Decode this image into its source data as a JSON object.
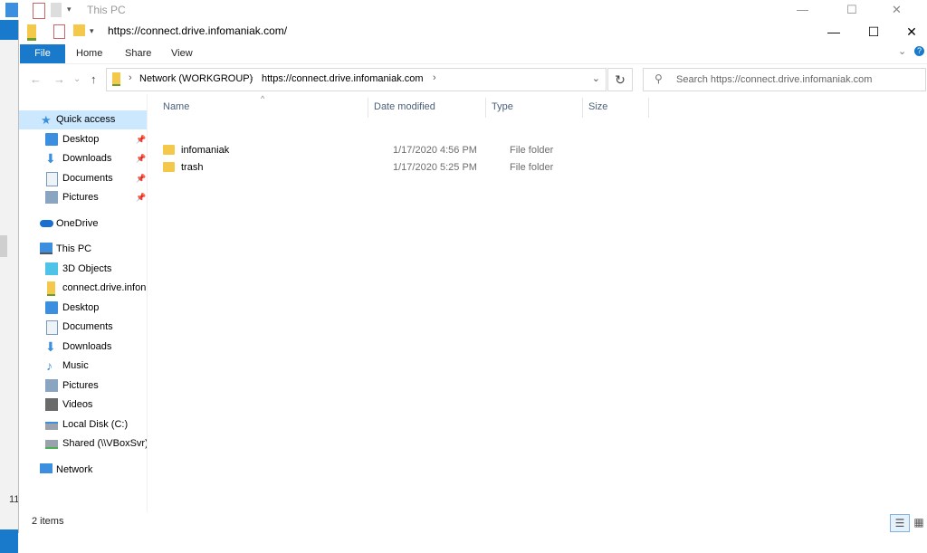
{
  "background_window": {
    "title": "This PC",
    "side_number": "11"
  },
  "window": {
    "title": "https://connect.drive.infomaniak.com/",
    "controls": {
      "minimize": "—",
      "maximize": "☐",
      "close": "✕"
    }
  },
  "ribbon": {
    "tabs": [
      "File",
      "Home",
      "Share",
      "View"
    ],
    "expand": "⌄",
    "help": "?"
  },
  "navigation": {
    "back": "←",
    "forward": "→",
    "recent": "⌄",
    "up": "↑",
    "address": {
      "segments": [
        "Network (WORKGROUP)",
        "https://connect.drive.infomaniak.com"
      ],
      "separator": "›",
      "dropdown": "⌄"
    },
    "refresh": "↻",
    "search": {
      "placeholder": "Search https://connect.drive.infomaniak.com",
      "icon": "search-icon"
    }
  },
  "sidebar": {
    "quick_access": "Quick access",
    "quick_items": [
      "Desktop",
      "Downloads",
      "Documents",
      "Pictures"
    ],
    "pin": "📌",
    "onedrive": "OneDrive",
    "this_pc": "This PC",
    "pc_items": [
      "3D Objects",
      "connect.drive.infon",
      "Desktop",
      "Documents",
      "Downloads",
      "Music",
      "Pictures",
      "Videos",
      "Local Disk (C:)",
      "Shared (\\\\VBoxSvr)"
    ],
    "network": "Network"
  },
  "list": {
    "columns": [
      "Name",
      "Date modified",
      "Type",
      "Size"
    ],
    "sort_caret": "^",
    "rows": [
      {
        "name": "infomaniak",
        "date": "1/17/2020 4:56 PM",
        "type": "File folder",
        "size": ""
      },
      {
        "name": "trash",
        "date": "1/17/2020 5:25 PM",
        "type": "File folder",
        "size": ""
      }
    ]
  },
  "status": {
    "count": "2 items",
    "view_details": "☰",
    "view_tiles": "▦"
  },
  "colors": {
    "accent": "#1979ca",
    "selection": "#cce8ff",
    "folder": "#f3c84b"
  }
}
